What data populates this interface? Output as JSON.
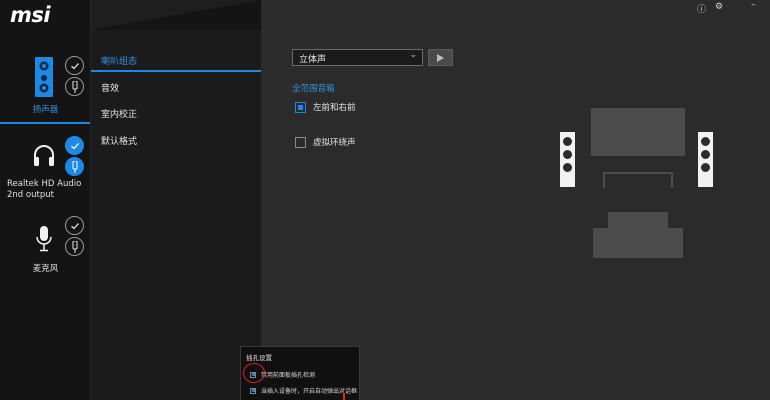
{
  "app": {
    "logo": "msi"
  },
  "top_icons": {
    "info": "ⓘ",
    "settings": "⚙",
    "minimize": "–"
  },
  "devices": [
    {
      "label": "扬声器",
      "icon": "speaker-icon",
      "active": true
    },
    {
      "label": "Realtek HD Audio 2nd output",
      "icon": "headphones-icon",
      "active": false
    },
    {
      "label": "麦克风",
      "icon": "microphone-icon",
      "active": false
    }
  ],
  "nav": {
    "items": [
      {
        "label": "喇叭组态",
        "active": true
      },
      {
        "label": "音效",
        "active": false
      },
      {
        "label": "室内校正",
        "active": false
      },
      {
        "label": "默认格式",
        "active": false
      }
    ]
  },
  "main": {
    "config_select": {
      "value": "立体声"
    },
    "group_label": "全范围音箱",
    "checks": [
      {
        "label": "左前和右前",
        "checked": true
      },
      {
        "label": "虚拟环绕声",
        "checked": false
      }
    ]
  },
  "popup": {
    "title": "插孔设置",
    "rows": [
      {
        "label": "禁用前面板插孔检测",
        "checked": true
      },
      {
        "label": "当插入设备时，开启自动弹出对话框",
        "checked": true
      }
    ]
  },
  "colors": {
    "accent": "#1e88e5",
    "highlight_circle": "#e02020"
  }
}
